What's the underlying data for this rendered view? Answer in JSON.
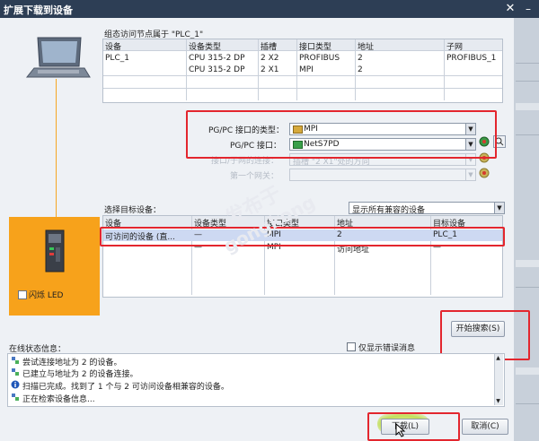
{
  "window": {
    "title": "扩展下载到设备",
    "close_glyph": "✕",
    "min_glyph": "–"
  },
  "config": {
    "caption": "组态访问节点属于 \"PLC_1\"",
    "headers": [
      "设备",
      "设备类型",
      "插槽",
      "接口类型",
      "地址",
      "子网"
    ],
    "rows": [
      [
        "PLC_1",
        "CPU 315-2 DP",
        "2 X2",
        "PROFIBUS",
        "2",
        "PROFIBUS_1"
      ],
      [
        "",
        "CPU 315-2 DP",
        "2 X1",
        "MPI",
        "2",
        ""
      ]
    ]
  },
  "iface": {
    "type_label": "PG/PC 接口的类型：",
    "type_value": "MPI",
    "iface_label": "PG/PC 接口：",
    "iface_value": "NetS7PD",
    "subnet_label": "接口/子网的连接：",
    "subnet_value": "插槽 \"2 X1\"处的方向",
    "gateway_label": "第一个网关："
  },
  "target": {
    "caption": "选择目标设备：",
    "filter_value": "显示所有兼容的设备",
    "headers": [
      "设备",
      "设备类型",
      "接口类型",
      "地址",
      "目标设备"
    ],
    "rows": [
      [
        "可访问的设备 (直...",
        "—",
        "MPI",
        "2",
        "PLC_1"
      ],
      [
        "",
        "—",
        "MPI",
        "访问地址",
        "—"
      ]
    ]
  },
  "led": {
    "label": "闪烁 LED"
  },
  "status": {
    "caption": "在线状态信息：",
    "errors_only": "仅显示错误消息",
    "messages": [
      {
        "icon": "connect-icon",
        "text": "尝试连接地址为 2 的设备。"
      },
      {
        "icon": "connect-icon",
        "text": "已建立与地址为 2 的设备连接。"
      },
      {
        "icon": "info-icon",
        "text": "扫描已完成。找到了 1 个与 2 可访问设备相兼容的设备。"
      },
      {
        "icon": "connect-icon",
        "text": "正在检索设备信息..."
      }
    ]
  },
  "buttons": {
    "search": "开始搜索(S)",
    "download": "下载(L)",
    "cancel": "取消(C)"
  },
  "watermark": {
    "line1": "发布于",
    "line2": "gongkong"
  },
  "colors": {
    "accent_red": "#e3262e",
    "selection": "#cdd9f2",
    "orange": "#f7a21b"
  }
}
